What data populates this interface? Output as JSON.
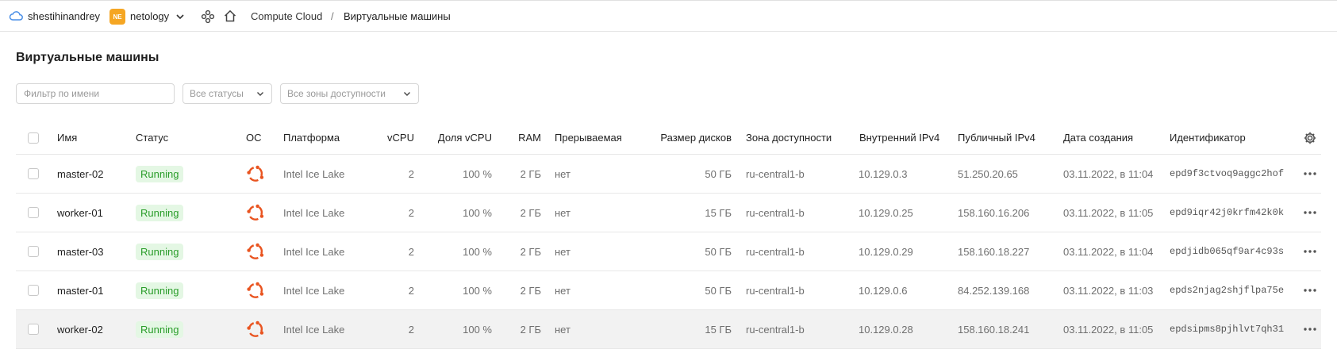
{
  "topbar": {
    "user": "shestihinandrey",
    "org_badge": "NE",
    "org": "netology",
    "breadcrumbs": [
      "Compute Cloud",
      "Виртуальные машины"
    ],
    "breadcrumb_separator": "/"
  },
  "page": {
    "title": "Виртуальные машины"
  },
  "filters": {
    "name_placeholder": "Фильтр по имени",
    "status_select": "Все статусы",
    "zone_select": "Все зоны доступности"
  },
  "table": {
    "columns": {
      "name": "Имя",
      "status": "Статус",
      "os": "ОС",
      "platform": "Платформа",
      "vcpu": "vCPU",
      "share": "Доля vCPU",
      "ram": "RAM",
      "preemptible": "Прерываемая",
      "disk": "Размер дисков",
      "zone": "Зона доступности",
      "internal_ip": "Внутренний IPv4",
      "public_ip": "Публичный IPv4",
      "created": "Дата создания",
      "id": "Идентификатор"
    },
    "rows": [
      {
        "name": "master-02",
        "status": "Running",
        "os": "ubuntu-icon",
        "platform": "Intel Ice Lake",
        "vcpu": "2",
        "share": "100 %",
        "ram": "2 ГБ",
        "preemptible": "нет",
        "disk": "50 ГБ",
        "zone": "ru-central1-b",
        "internal_ip": "10.129.0.3",
        "public_ip": "51.250.20.65",
        "created": "03.11.2022, в 11:04",
        "id": "epd9f3ctvoq9aggc2hof"
      },
      {
        "name": "worker-01",
        "status": "Running",
        "os": "ubuntu-icon",
        "platform": "Intel Ice Lake",
        "vcpu": "2",
        "share": "100 %",
        "ram": "2 ГБ",
        "preemptible": "нет",
        "disk": "15 ГБ",
        "zone": "ru-central1-b",
        "internal_ip": "10.129.0.25",
        "public_ip": "158.160.16.206",
        "created": "03.11.2022, в 11:05",
        "id": "epd9iqr42j0krfm42k0k"
      },
      {
        "name": "master-03",
        "status": "Running",
        "os": "ubuntu-icon",
        "platform": "Intel Ice Lake",
        "vcpu": "2",
        "share": "100 %",
        "ram": "2 ГБ",
        "preemptible": "нет",
        "disk": "50 ГБ",
        "zone": "ru-central1-b",
        "internal_ip": "10.129.0.29",
        "public_ip": "158.160.18.227",
        "created": "03.11.2022, в 11:04",
        "id": "epdjidb065qf9ar4c93s"
      },
      {
        "name": "master-01",
        "status": "Running",
        "os": "ubuntu-icon",
        "platform": "Intel Ice Lake",
        "vcpu": "2",
        "share": "100 %",
        "ram": "2 ГБ",
        "preemptible": "нет",
        "disk": "50 ГБ",
        "zone": "ru-central1-b",
        "internal_ip": "10.129.0.6",
        "public_ip": "84.252.139.168",
        "created": "03.11.2022, в 11:03",
        "id": "epds2njag2shjflpa75e"
      },
      {
        "name": "worker-02",
        "status": "Running",
        "os": "ubuntu-icon",
        "platform": "Intel Ice Lake",
        "vcpu": "2",
        "share": "100 %",
        "ram": "2 ГБ",
        "preemptible": "нет",
        "disk": "15 ГБ",
        "zone": "ru-central1-b",
        "internal_ip": "10.129.0.28",
        "public_ip": "158.160.18.241",
        "created": "03.11.2022, в 11:05",
        "id": "epdsipms8pjhlvt7qh31"
      }
    ]
  },
  "colors": {
    "org_badge": "#f5a623",
    "status_running_bg": "#e4f7e4",
    "status_running_text": "#2a9d2a",
    "ubuntu": "#e95420"
  }
}
